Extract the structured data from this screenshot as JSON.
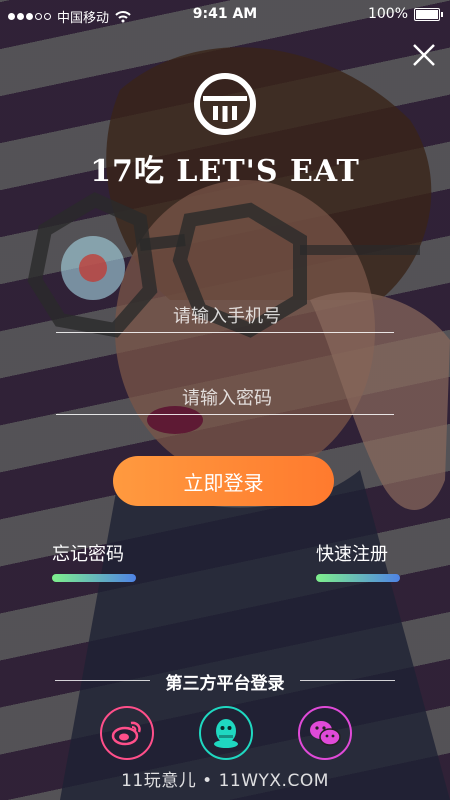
{
  "status_bar": {
    "carrier": "中国移动",
    "time": "9:41 AM",
    "battery": "100%"
  },
  "brand": {
    "name": "17吃 LET'S EAT"
  },
  "form": {
    "phone_placeholder": "请输入手机号",
    "password_placeholder": "请输入密码",
    "login_label": "立即登录"
  },
  "links": {
    "forgot_label": "忘记密码",
    "register_label": "快速注册"
  },
  "third_party": {
    "title": "第三方平台登录",
    "providers": [
      "weibo-icon",
      "qq-icon",
      "wechat-icon"
    ]
  },
  "watermark": "11玩意儿 • 11WYX.COM",
  "colors": {
    "login_button": "#ff8a35",
    "link_bar_start": "#7ef08c",
    "link_bar_end": "#4f83e6",
    "weibo": "#ff4f8a",
    "qq": "#1fd8c1",
    "wechat": "#e04ad8"
  }
}
